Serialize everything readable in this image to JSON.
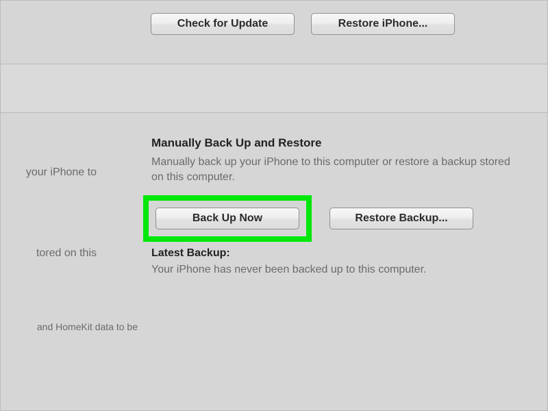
{
  "top": {
    "check_update_label": "Check for Update",
    "restore_iphone_label": "Restore iPhone..."
  },
  "left_fragments": {
    "frag1": "your iPhone to",
    "frag2": "tored on this",
    "frag3": "and HomeKit data to be"
  },
  "backup_section": {
    "title": "Manually Back Up and Restore",
    "description": "Manually back up your iPhone to this computer or restore a backup stored on this computer.",
    "backup_now_label": "Back Up Now",
    "restore_backup_label": "Restore Backup..."
  },
  "latest_backup": {
    "title": "Latest Backup:",
    "status": "Your iPhone has never been backed up to this computer."
  },
  "highlight_color": "#00e80b"
}
